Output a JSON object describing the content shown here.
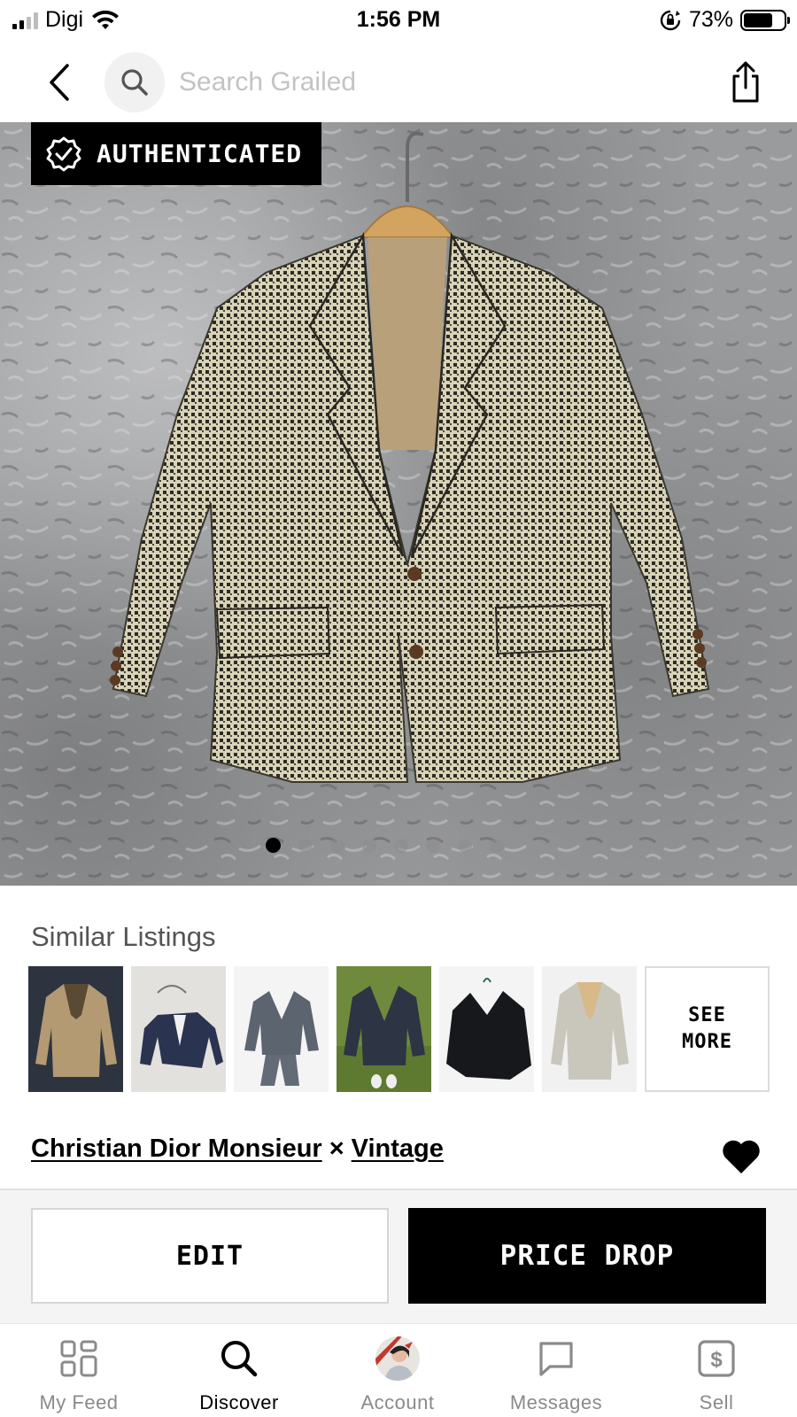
{
  "status_bar": {
    "carrier": "Digi",
    "time": "1:56 PM",
    "battery_percent": "73%",
    "battery_level": 0.73,
    "signal_bars": 2
  },
  "nav": {
    "back_icon": "chevron-left-icon",
    "search_placeholder": "Search Grailed",
    "share_icon": "share-icon"
  },
  "hero": {
    "badge_label": "AUTHENTICATED",
    "image_count": 8,
    "active_image": 1
  },
  "similar": {
    "title": "Similar Listings",
    "see_more_label": "SEE\nMORE"
  },
  "listing": {
    "brand_1": "Christian Dior Monsieur",
    "separator": "×",
    "brand_2": "Vintage"
  },
  "actions": {
    "edit_label": "EDIT",
    "price_drop_label": "PRICE DROP"
  },
  "tabs": [
    {
      "label": "My Feed",
      "icon": "feed-grid-icon"
    },
    {
      "label": "Discover",
      "icon": "search-icon"
    },
    {
      "label": "Account",
      "icon": "avatar"
    },
    {
      "label": "Messages",
      "icon": "chat-bubble-icon"
    },
    {
      "label": "Sell",
      "icon": "dollar-tag-icon"
    }
  ],
  "active_tab": "Discover"
}
